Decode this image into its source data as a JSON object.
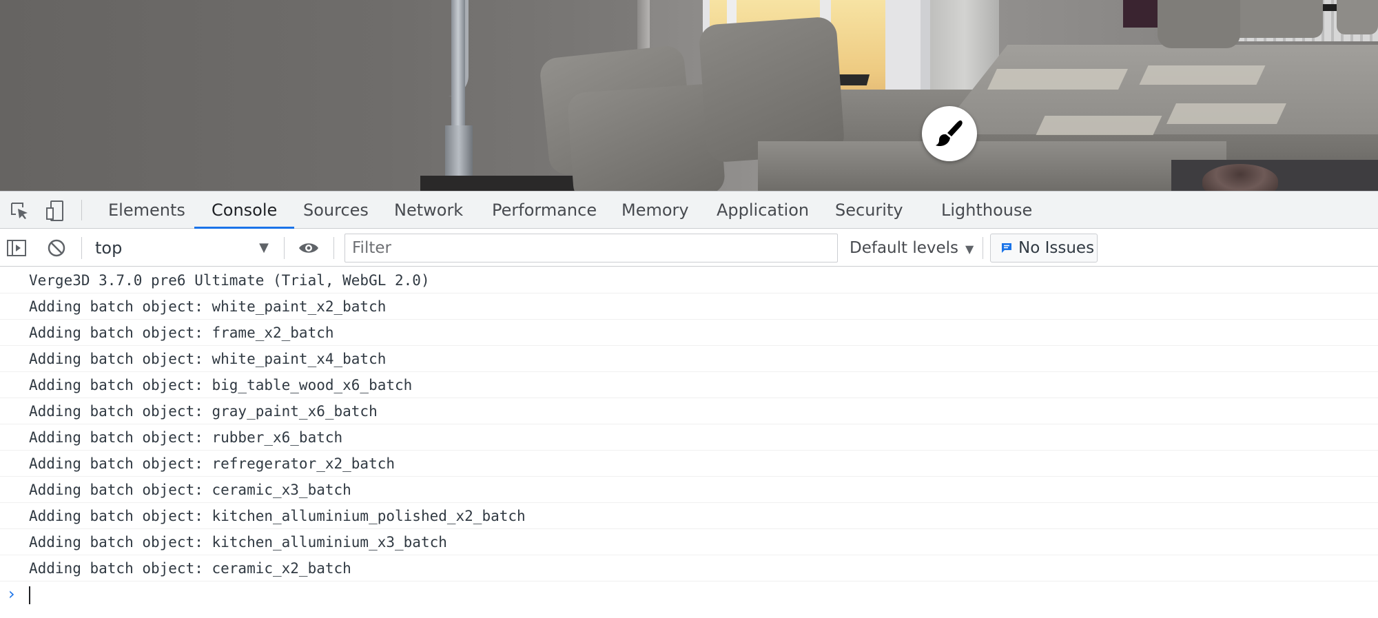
{
  "devtools": {
    "tabs": [
      {
        "label": "Elements"
      },
      {
        "label": "Console",
        "active": true
      },
      {
        "label": "Sources"
      },
      {
        "label": "Network"
      },
      {
        "label": "Performance"
      },
      {
        "label": "Memory"
      },
      {
        "label": "Application"
      },
      {
        "label": "Security"
      },
      {
        "label": "Lighthouse"
      }
    ],
    "toolbar": {
      "context": "top",
      "filter_placeholder": "Filter",
      "levels_label": "Default levels",
      "issues_label": "No Issues"
    },
    "console_messages": [
      "Verge3D 3.7.0 pre6 Ultimate (Trial, WebGL 2.0)",
      "Adding batch object: white_paint_x2_batch",
      "Adding batch object: frame_x2_batch",
      "Adding batch object: white_paint_x4_batch",
      "Adding batch object: big_table_wood_x6_batch",
      "Adding batch object: gray_paint_x6_batch",
      "Adding batch object: rubber_x6_batch",
      "Adding batch object: refregerator_x2_batch",
      "Adding batch object: ceramic_x3_batch",
      "Adding batch object: kitchen_alluminium_polished_x2_batch",
      "Adding batch object: kitchen_alluminium_x3_batch",
      "Adding batch object: ceramic_x2_batch"
    ],
    "prompt_symbol": "›"
  },
  "icons": {
    "viewport_button": "paint-brush-icon",
    "inspect": "inspect-element-icon",
    "device": "device-toolbar-icon",
    "sidebar": "show-sidebar-icon",
    "clear": "clear-console-icon",
    "eye": "live-expression-eye-icon",
    "issues": "issues-message-icon"
  },
  "colors": {
    "accent": "#1a73e8",
    "text": "#303942"
  }
}
